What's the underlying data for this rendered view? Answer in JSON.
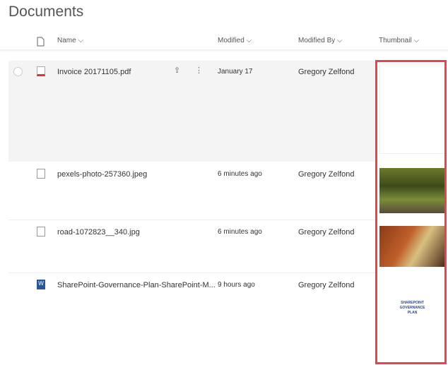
{
  "title": "Documents",
  "columns": {
    "name": "Name",
    "modified": "Modified",
    "modified_by": "Modified By",
    "thumbnail": "Thumbnail"
  },
  "files": [
    {
      "name": "Invoice 20171105.pdf",
      "modified": "January 17",
      "modified_by": "Gregory Zelfond",
      "icon": "pdf-icon"
    },
    {
      "name": "pexels-photo-257360.jpeg",
      "modified": "6 minutes ago",
      "modified_by": "Gregory Zelfond",
      "icon": "image-icon"
    },
    {
      "name": "road-1072823__340.jpg",
      "modified": "6 minutes ago",
      "modified_by": "Gregory Zelfond",
      "icon": "image-icon"
    },
    {
      "name": "SharePoint-Governance-Plan-SharePoint-M...",
      "modified": "9 hours ago",
      "modified_by": "Gregory Zelfond",
      "icon": "word-icon"
    }
  ],
  "thumbnail_doc_text": "SHAREPOINT GOVERNANCE PLAN",
  "colors": {
    "highlight": "#e8434a",
    "selected_row": "#f4f4f4"
  }
}
